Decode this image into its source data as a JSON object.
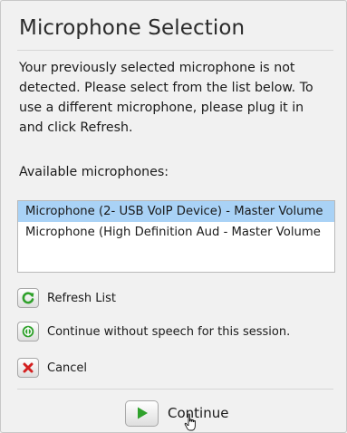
{
  "dialog": {
    "title": "Microphone Selection",
    "message": "Your previously selected microphone is not detected.  Please select from the list below.  To use a different microphone, please plug it in and click Refresh.",
    "available_label": "Available microphones:"
  },
  "microphones": {
    "items": [
      "Microphone (2- USB VoIP Device) - Master Volume",
      "Microphone (High Definition Aud - Master Volume"
    ],
    "selected": "Microphone (2- USB VoIP Device) - Master Volume"
  },
  "actions": {
    "refresh_label": "Refresh List",
    "continue_without_label": "Continue without speech for this session.",
    "cancel_label": "Cancel"
  },
  "footer": {
    "continue_label": "Continue"
  },
  "icons": {
    "refresh": "refresh-icon",
    "continue_without": "no-speech-icon",
    "cancel": "cancel-x-icon",
    "continue": "play-icon",
    "cursor": "hand-cursor-icon"
  },
  "colors": {
    "selection": "#a9d2f6",
    "green": "#2fa12b",
    "red": "#d42020"
  }
}
